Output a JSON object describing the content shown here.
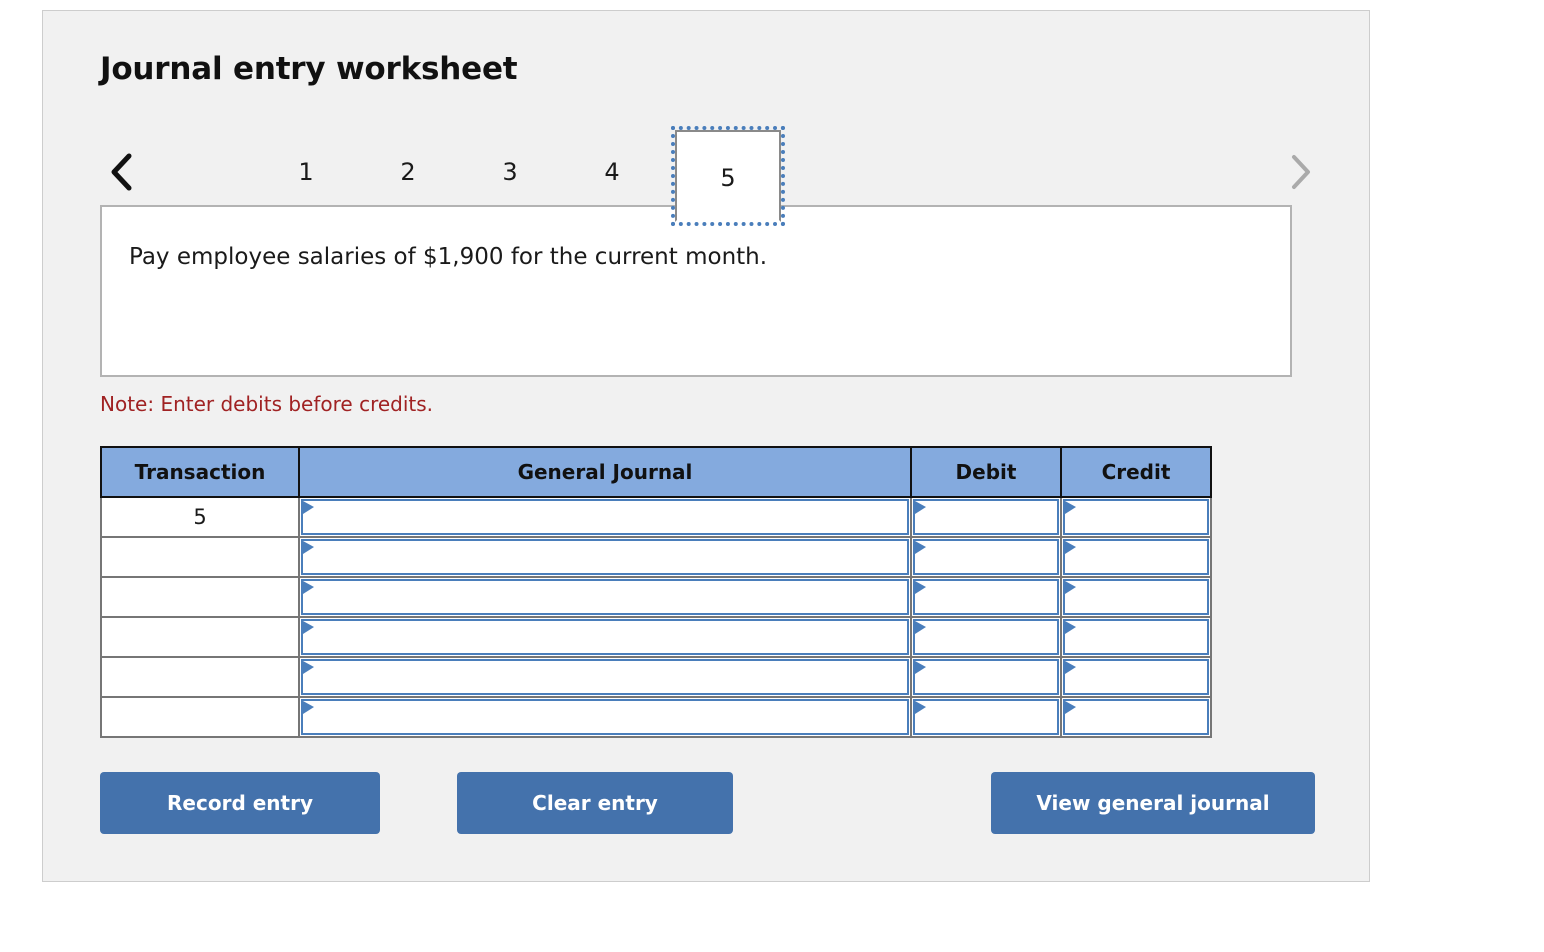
{
  "panel": {
    "title": "Journal entry worksheet"
  },
  "nav": {
    "prev_icon": "chevron-left-icon",
    "next_icon": "chevron-right-icon",
    "tabs": [
      {
        "label": "1",
        "active": false
      },
      {
        "label": "2",
        "active": false
      },
      {
        "label": "3",
        "active": false
      },
      {
        "label": "4",
        "active": false
      },
      {
        "label": "5",
        "active": true
      }
    ]
  },
  "instruction": {
    "text": "Pay employee salaries of $1,900 for the current month."
  },
  "note": {
    "text": "Note: Enter debits before credits."
  },
  "table": {
    "headers": {
      "transaction": "Transaction",
      "general_journal": "General Journal",
      "debit": "Debit",
      "credit": "Credit"
    },
    "rows": [
      {
        "transaction": "5",
        "general_journal": "",
        "debit": "",
        "credit": ""
      },
      {
        "transaction": "",
        "general_journal": "",
        "debit": "",
        "credit": ""
      },
      {
        "transaction": "",
        "general_journal": "",
        "debit": "",
        "credit": ""
      },
      {
        "transaction": "",
        "general_journal": "",
        "debit": "",
        "credit": ""
      },
      {
        "transaction": "",
        "general_journal": "",
        "debit": "",
        "credit": ""
      },
      {
        "transaction": "",
        "general_journal": "",
        "debit": "",
        "credit": ""
      }
    ]
  },
  "buttons": {
    "record": "Record entry",
    "clear": "Clear entry",
    "view": "View general journal"
  },
  "colors": {
    "panel_bg": "#f1f1f1",
    "header_blue": "#84aade",
    "button_blue": "#4472ac",
    "field_border_blue": "#4a7ebb",
    "note_red": "#a02223",
    "next_arrow_gray": "#aaaaaa"
  }
}
